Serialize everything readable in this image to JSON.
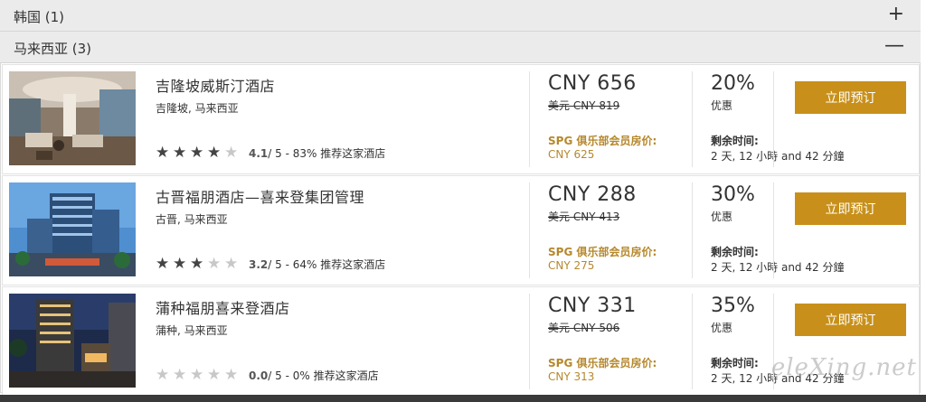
{
  "regions": {
    "korea": {
      "label": "韩国 (1)",
      "toggle": "+"
    },
    "malaysia": {
      "label": "马来西亚 (3)",
      "toggle": "—"
    }
  },
  "hotels": [
    {
      "name": "吉隆坡威斯汀酒店",
      "location": "吉隆坡, 马来西亚",
      "stars_filled": 4,
      "stars_total": 5,
      "star_glyph": "★",
      "score": "4.1",
      "score_suffix": " / 5 - 83% 推荐这家酒店",
      "price": "CNY 656",
      "original_price": "美元 CNY 819",
      "spg_label": "SPG 俱乐部会员房价:",
      "spg_price": "CNY 625",
      "discount": "20%",
      "discount_label": "优惠",
      "time_label": "剩余时间:",
      "time_value": "2 天, 12 小時 and 42 分鐘",
      "button": "立即预订"
    },
    {
      "name": "古晋福朋酒店—喜来登集团管理",
      "location": "古晋, 马来西亚",
      "stars_filled": 3,
      "stars_total": 5,
      "star_glyph": "★",
      "score": "3.2",
      "score_suffix": " / 5 - 64% 推荐这家酒店",
      "price": "CNY 288",
      "original_price": "美元 CNY 413",
      "spg_label": "SPG 俱乐部会员房价:",
      "spg_price": "CNY 275",
      "discount": "30%",
      "discount_label": "优惠",
      "time_label": "剩余时间:",
      "time_value": "2 天, 12 小時 and 42 分鐘",
      "button": "立即预订"
    },
    {
      "name": "蒲种福朋喜来登酒店",
      "location": "蒲种, 马来西亚",
      "stars_filled": 0,
      "stars_total": 5,
      "star_glyph": "★",
      "score": "0.0",
      "score_suffix": " / 5 - 0% 推荐这家酒店",
      "price": "CNY 331",
      "original_price": "美元 CNY 506",
      "spg_label": "SPG 俱乐部会员房价:",
      "spg_price": "CNY 313",
      "discount": "35%",
      "discount_label": "优惠",
      "time_label": "剩余时间:",
      "time_value": "2 天, 12 小時 and 42 分鐘",
      "button": "立即预订"
    }
  ],
  "watermark": "eleXing.net",
  "colors": {
    "accent": "#c8901a",
    "spg_text": "#b6882c",
    "region_bg": "#ecebec",
    "star_on": "#444444",
    "star_off": "#c8c8c8"
  }
}
